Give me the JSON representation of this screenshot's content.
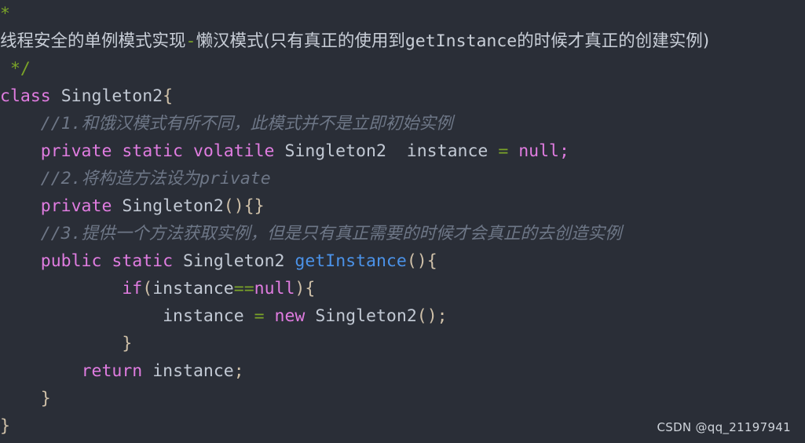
{
  "editor": {
    "background_color": "#2a2e37",
    "default_text_color": "#c5ccd6",
    "font_size_px": 21.5,
    "line_height_px": 35
  },
  "theme_colors": {
    "comment": "#6e7787",
    "block_comment": "#7ba428",
    "keyword": "#e07ce0",
    "identifier": "#c2c9d4",
    "function": "#4b92e8",
    "operator": "#7ba428",
    "punctuation": "#cfc0a8"
  },
  "code": {
    "language": "Java",
    "lines": [
      {
        "id": "line-1",
        "indent": "",
        "tokens": [
          {
            "type": "block-comment",
            "text": "*"
          }
        ]
      },
      {
        "id": "line-2",
        "indent": "",
        "tokens": [
          {
            "type": "doc-text-cjk",
            "text": "线程安全的单例模式实现"
          },
          {
            "type": "operator",
            "text": "-"
          },
          {
            "type": "doc-text-cjk",
            "text": "懒汉模式(只有真正的使用到"
          },
          {
            "type": "doc-text",
            "text": "getInstance"
          },
          {
            "type": "doc-text-cjk",
            "text": "的时候才真正的创建实例)"
          }
        ]
      },
      {
        "id": "line-3",
        "indent": " ",
        "tokens": [
          {
            "type": "block-comment",
            "text": "*/"
          }
        ]
      },
      {
        "id": "line-4",
        "indent": "",
        "tokens": [
          {
            "type": "keyword",
            "text": "class"
          },
          {
            "type": "plain",
            "text": " "
          },
          {
            "type": "type",
            "text": "Singleton2"
          },
          {
            "type": "punct",
            "text": "{"
          }
        ]
      },
      {
        "id": "line-5",
        "indent": "    ",
        "tokens": [
          {
            "type": "comment",
            "text": "//1."
          },
          {
            "type": "comment-cjk",
            "text": "和饿汉模式有所不同，此模式并不是立即初始实例"
          }
        ]
      },
      {
        "id": "line-6",
        "indent": "    ",
        "tokens": [
          {
            "type": "keyword",
            "text": "private static volatile"
          },
          {
            "type": "plain",
            "text": " "
          },
          {
            "type": "type",
            "text": "Singleton2"
          },
          {
            "type": "plain",
            "text": "  "
          },
          {
            "type": "ident",
            "text": "instance"
          },
          {
            "type": "plain",
            "text": " "
          },
          {
            "type": "operator",
            "text": "="
          },
          {
            "type": "plain",
            "text": " "
          },
          {
            "type": "keyword",
            "text": "null"
          },
          {
            "type": "keyword",
            "text": ";"
          }
        ]
      },
      {
        "id": "line-7",
        "indent": "    ",
        "tokens": [
          {
            "type": "comment",
            "text": "//2."
          },
          {
            "type": "comment-cjk",
            "text": "将构造方法设为"
          },
          {
            "type": "comment",
            "text": "private"
          }
        ]
      },
      {
        "id": "line-8",
        "indent": "    ",
        "tokens": [
          {
            "type": "keyword",
            "text": "private"
          },
          {
            "type": "plain",
            "text": " "
          },
          {
            "type": "type",
            "text": "Singleton2"
          },
          {
            "type": "punct",
            "text": "(){}"
          }
        ]
      },
      {
        "id": "line-9",
        "indent": "    ",
        "tokens": [
          {
            "type": "comment",
            "text": "//3."
          },
          {
            "type": "comment-cjk",
            "text": "提供一个方法获取实例，但是只有真正需要的时候才会真正的去创造实例"
          }
        ]
      },
      {
        "id": "line-10",
        "indent": "    ",
        "tokens": [
          {
            "type": "keyword",
            "text": "public static"
          },
          {
            "type": "plain",
            "text": " "
          },
          {
            "type": "type",
            "text": "Singleton2"
          },
          {
            "type": "plain",
            "text": " "
          },
          {
            "type": "func",
            "text": "getInstance"
          },
          {
            "type": "punct",
            "text": "(){"
          }
        ]
      },
      {
        "id": "line-11",
        "indent": "            ",
        "tokens": [
          {
            "type": "keyword",
            "text": "if"
          },
          {
            "type": "punct",
            "text": "("
          },
          {
            "type": "ident",
            "text": "instance"
          },
          {
            "type": "operator",
            "text": "=="
          },
          {
            "type": "keyword",
            "text": "null"
          },
          {
            "type": "punct",
            "text": "){"
          }
        ]
      },
      {
        "id": "line-12",
        "indent": "                ",
        "tokens": [
          {
            "type": "ident",
            "text": "instance"
          },
          {
            "type": "plain",
            "text": " "
          },
          {
            "type": "operator",
            "text": "="
          },
          {
            "type": "plain",
            "text": " "
          },
          {
            "type": "keyword",
            "text": "new"
          },
          {
            "type": "plain",
            "text": " "
          },
          {
            "type": "type",
            "text": "Singleton2"
          },
          {
            "type": "punct",
            "text": "();"
          }
        ]
      },
      {
        "id": "line-13",
        "indent": "            ",
        "tokens": [
          {
            "type": "punct",
            "text": "}"
          }
        ]
      },
      {
        "id": "line-14",
        "indent": "        ",
        "tokens": [
          {
            "type": "keyword",
            "text": "return"
          },
          {
            "type": "plain",
            "text": " "
          },
          {
            "type": "ident",
            "text": "instance"
          },
          {
            "type": "punct",
            "text": ";"
          }
        ]
      },
      {
        "id": "line-15",
        "indent": "    ",
        "tokens": [
          {
            "type": "punct",
            "text": "}"
          }
        ]
      },
      {
        "id": "line-16",
        "indent": "",
        "tokens": [
          {
            "type": "punct",
            "text": "}"
          }
        ]
      }
    ]
  },
  "watermark": {
    "text": "CSDN @qq_21197941"
  }
}
